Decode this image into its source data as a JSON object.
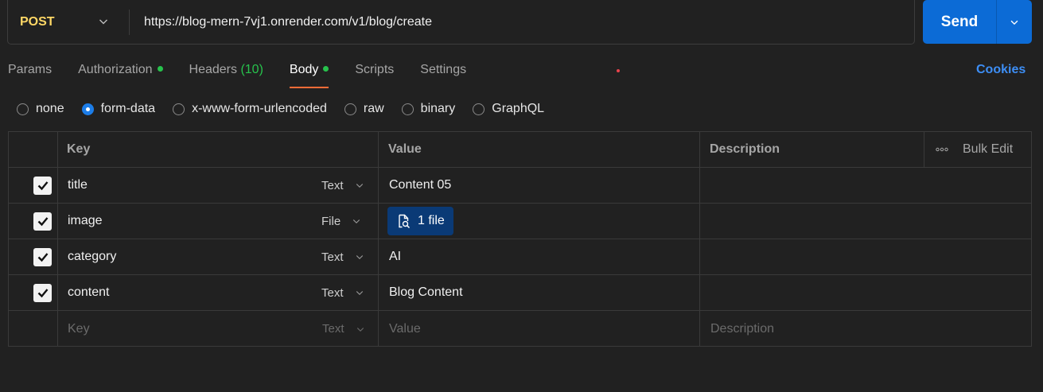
{
  "request": {
    "method": "POST",
    "url": "https://blog-mern-7vj1.onrender.com/v1/blog/create",
    "send_label": "Send"
  },
  "tabs": {
    "params": "Params",
    "authorization": "Authorization",
    "headers": "Headers",
    "headers_count": "(10)",
    "body": "Body",
    "scripts": "Scripts",
    "settings": "Settings",
    "active": "Body"
  },
  "cookies_label": "Cookies",
  "body_types": {
    "none": "none",
    "form_data": "form-data",
    "urlencoded": "x-www-form-urlencoded",
    "raw": "raw",
    "binary": "binary",
    "graphql": "GraphQL",
    "selected": "form-data"
  },
  "table": {
    "headers": {
      "key": "Key",
      "value": "Value",
      "description": "Description",
      "bulk_edit": "Bulk Edit"
    },
    "rows": [
      {
        "checked": true,
        "key": "title",
        "type": "Text",
        "value": "Content 05"
      },
      {
        "checked": true,
        "key": "image",
        "type": "File",
        "value": "1 file"
      },
      {
        "checked": true,
        "key": "category",
        "type": "Text",
        "value": "AI"
      },
      {
        "checked": true,
        "key": "content",
        "type": "Text",
        "value": "Blog Content"
      }
    ],
    "new_row": {
      "key_placeholder": "Key",
      "type": "Text",
      "value_placeholder": "Value",
      "description_placeholder": "Description"
    }
  },
  "colors": {
    "background": "#212121",
    "method": "#ffd866",
    "send": "#0c6bd6",
    "active_tab_underline": "#ff6c37",
    "status_dot": "#27c24c",
    "link": "#3d8ef5",
    "file_pill": "#0a3a76"
  }
}
